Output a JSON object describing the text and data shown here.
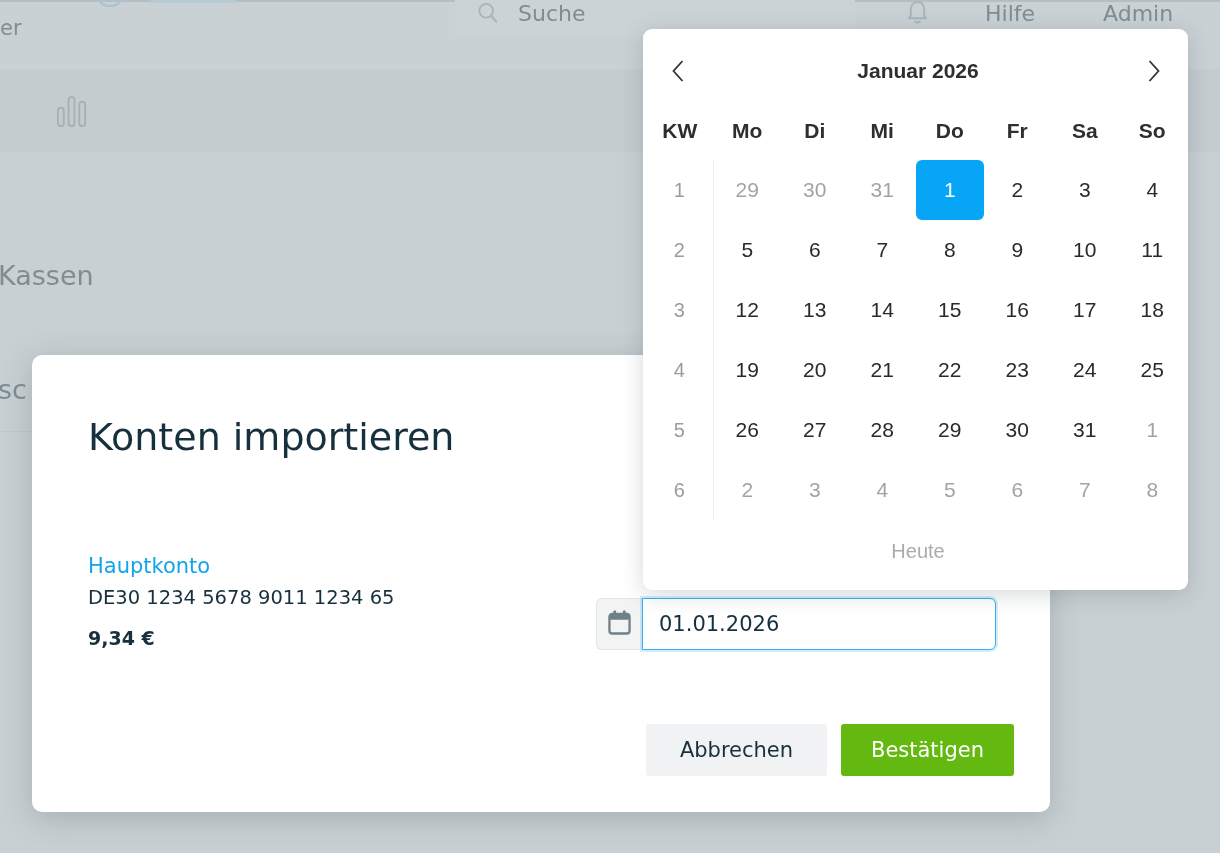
{
  "app_background": {
    "top_bar": {
      "left_text": "er",
      "search": {
        "placeholder": "Suche"
      },
      "links": [
        "Hilfe",
        "Admin"
      ]
    },
    "content": {
      "items": [
        "Kassen",
        "sc"
      ]
    }
  },
  "dialog": {
    "title": "Konten importieren",
    "account": {
      "name": "Hauptkonto",
      "iban": "DE30 1234 5678 9011 1234 65",
      "balance": "9,34 €"
    },
    "date_field": {
      "value": "01.01.2026",
      "focused": true
    },
    "buttons": [
      {
        "label": "Abbrechen",
        "kind": "secondary"
      },
      {
        "label": "Bestätigen",
        "kind": "primary"
      }
    ]
  },
  "datepicker": {
    "month": "Januar 2026",
    "week_header": "KW",
    "weekdays": [
      "Mo",
      "Di",
      "Mi",
      "Do",
      "Fr",
      "Sa",
      "So"
    ],
    "weeks": [
      {
        "week": "1",
        "days": [
          {
            "label": "29",
            "outside": true,
            "selected": false
          },
          {
            "label": "30",
            "outside": true,
            "selected": false
          },
          {
            "label": "31",
            "outside": true,
            "selected": false
          },
          {
            "label": "1",
            "outside": false,
            "selected": true
          },
          {
            "label": "2",
            "outside": false,
            "selected": false
          },
          {
            "label": "3",
            "outside": false,
            "selected": false
          },
          {
            "label": "4",
            "outside": false,
            "selected": false
          }
        ]
      },
      {
        "week": "2",
        "days": [
          {
            "label": "5",
            "outside": false,
            "selected": false
          },
          {
            "label": "6",
            "outside": false,
            "selected": false
          },
          {
            "label": "7",
            "outside": false,
            "selected": false
          },
          {
            "label": "8",
            "outside": false,
            "selected": false
          },
          {
            "label": "9",
            "outside": false,
            "selected": false
          },
          {
            "label": "10",
            "outside": false,
            "selected": false
          },
          {
            "label": "11",
            "outside": false,
            "selected": false
          }
        ]
      },
      {
        "week": "3",
        "days": [
          {
            "label": "12",
            "outside": false,
            "selected": false
          },
          {
            "label": "13",
            "outside": false,
            "selected": false
          },
          {
            "label": "14",
            "outside": false,
            "selected": false
          },
          {
            "label": "15",
            "outside": false,
            "selected": false
          },
          {
            "label": "16",
            "outside": false,
            "selected": false
          },
          {
            "label": "17",
            "outside": false,
            "selected": false
          },
          {
            "label": "18",
            "outside": false,
            "selected": false
          }
        ]
      },
      {
        "week": "4",
        "days": [
          {
            "label": "19",
            "outside": false,
            "selected": false
          },
          {
            "label": "20",
            "outside": false,
            "selected": false
          },
          {
            "label": "21",
            "outside": false,
            "selected": false
          },
          {
            "label": "22",
            "outside": false,
            "selected": false
          },
          {
            "label": "23",
            "outside": false,
            "selected": false
          },
          {
            "label": "24",
            "outside": false,
            "selected": false
          },
          {
            "label": "25",
            "outside": false,
            "selected": false
          }
        ]
      },
      {
        "week": "5",
        "days": [
          {
            "label": "26",
            "outside": false,
            "selected": false
          },
          {
            "label": "27",
            "outside": false,
            "selected": false
          },
          {
            "label": "28",
            "outside": false,
            "selected": false
          },
          {
            "label": "29",
            "outside": false,
            "selected": false
          },
          {
            "label": "30",
            "outside": false,
            "selected": false
          },
          {
            "label": "31",
            "outside": false,
            "selected": false
          },
          {
            "label": "1",
            "outside": true,
            "selected": false
          }
        ]
      },
      {
        "week": "6",
        "days": [
          {
            "label": "2",
            "outside": true,
            "selected": false
          },
          {
            "label": "3",
            "outside": true,
            "selected": false
          },
          {
            "label": "4",
            "outside": true,
            "selected": false
          },
          {
            "label": "5",
            "outside": true,
            "selected": false
          },
          {
            "label": "6",
            "outside": true,
            "selected": false
          },
          {
            "label": "7",
            "outside": true,
            "selected": false
          },
          {
            "label": "8",
            "outside": true,
            "selected": false
          }
        ]
      }
    ],
    "today_button": "Heute"
  }
}
